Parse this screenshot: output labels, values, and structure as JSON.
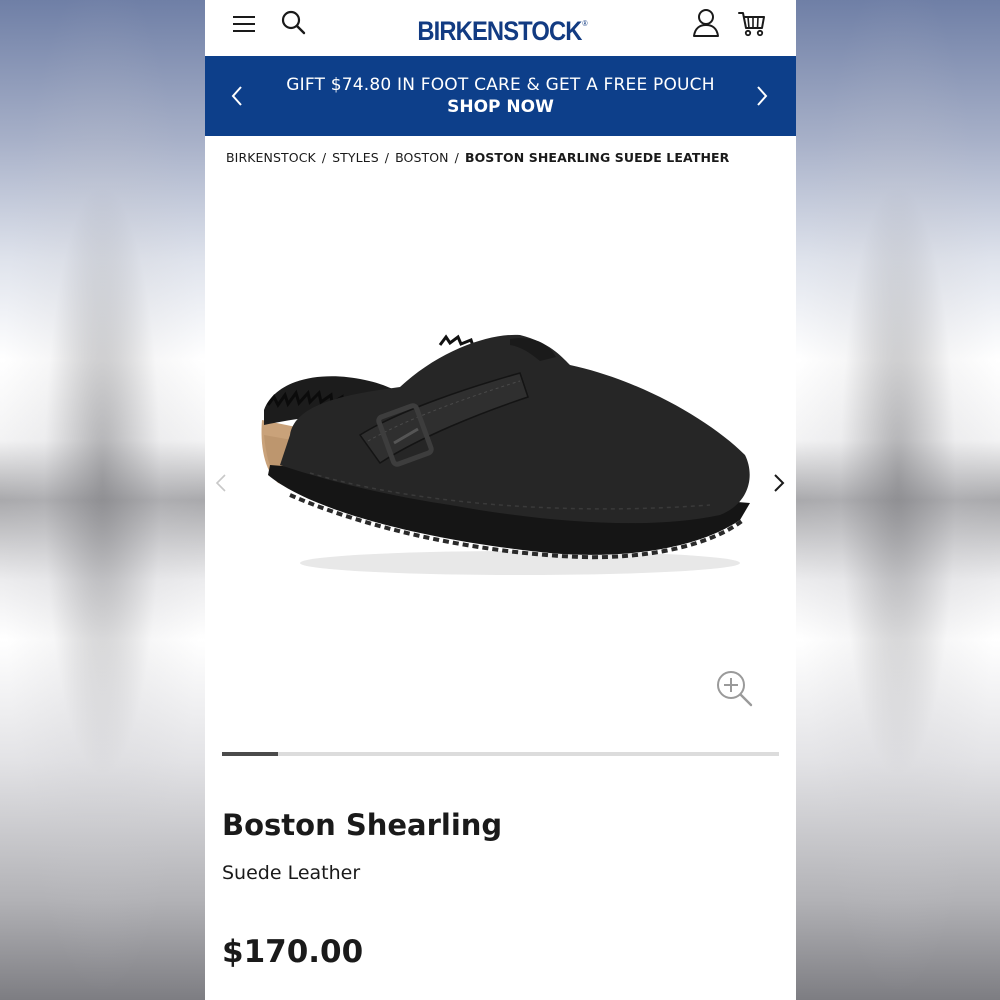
{
  "header": {
    "logo": "BIRKENSTOCK",
    "logo_mark": "®",
    "icons": {
      "menu": "hamburger-menu-icon",
      "search": "search-icon",
      "account": "user-account-icon",
      "cart": "shopping-cart-icon"
    }
  },
  "promo": {
    "message": "GIFT $74.80 IN FOOT CARE & GET A FREE POUCH",
    "cta": "SHOP NOW",
    "background_color": "#0d3f8a",
    "text_color": "#ffffff"
  },
  "breadcrumb": {
    "items": [
      "BIRKENSTOCK",
      "STYLES",
      "BOSTON"
    ],
    "separator": "/",
    "current": "BOSTON SHEARLING SUEDE LEATHER"
  },
  "gallery": {
    "image_subject": "black suede shearling-lined clog",
    "prev_icon": "chevron-left-icon",
    "next_icon": "chevron-right-icon",
    "zoom_icon": "zoom-in-icon",
    "progress_fraction": 0.1
  },
  "product": {
    "name": "Boston Shearling",
    "material": "Suede Leather",
    "price": "$170.00"
  },
  "colors": {
    "brand": "#123b82",
    "text": "#1a1a1a"
  }
}
